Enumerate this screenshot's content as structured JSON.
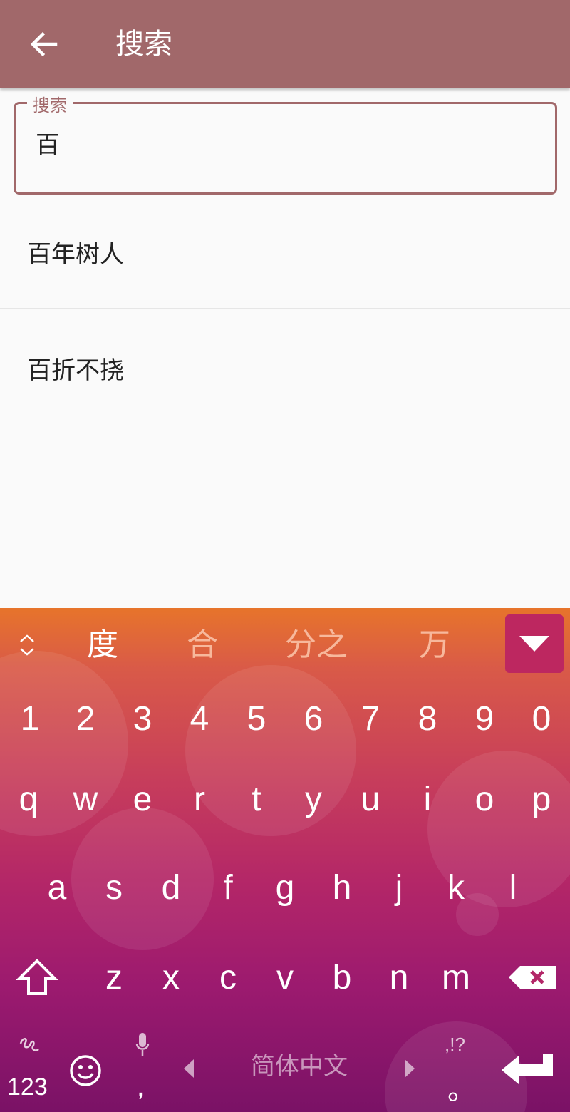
{
  "appbar": {
    "title": "搜索"
  },
  "search": {
    "label": "搜索",
    "value": "百"
  },
  "results": [
    "百年树人",
    "百折不挠"
  ],
  "keyboard": {
    "candidates": [
      "度",
      "合",
      "分之",
      "万"
    ],
    "number_row": [
      "1",
      "2",
      "3",
      "4",
      "5",
      "6",
      "7",
      "8",
      "9",
      "0"
    ],
    "row1": [
      "q",
      "w",
      "e",
      "r",
      "t",
      "y",
      "u",
      "i",
      "o",
      "p"
    ],
    "row2": [
      "a",
      "s",
      "d",
      "f",
      "g",
      "h",
      "j",
      "k",
      "l"
    ],
    "row3": [
      "z",
      "x",
      "c",
      "v",
      "b",
      "n",
      "m"
    ],
    "symbols_key": "123",
    "comma_key": ",",
    "language_label": "简体中文",
    "punct_top": ",!?",
    "punct_bottom": "。"
  },
  "colors": {
    "accent": "#a1686a",
    "keyboard_accent": "#bd2760"
  }
}
